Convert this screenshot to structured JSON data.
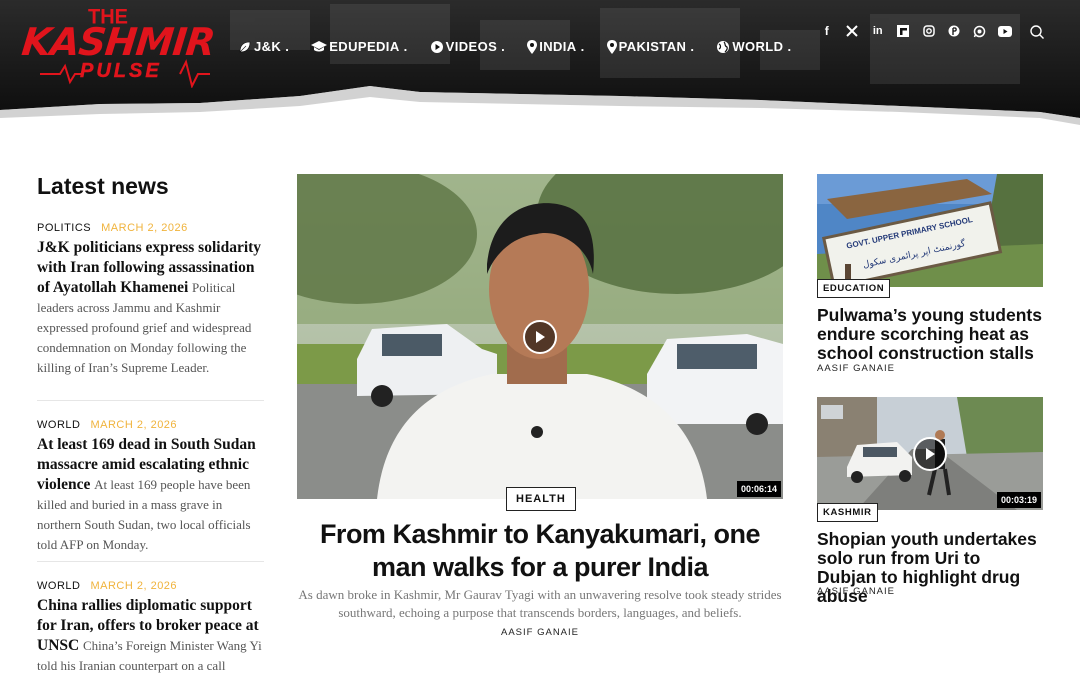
{
  "brand": {
    "the": "THE",
    "name": "KASHMIR",
    "tagline": "PULSE",
    "accent": "#e1141c"
  },
  "nav": {
    "items": [
      {
        "label": "J&K",
        "icon": "leaf-icon"
      },
      {
        "label": "EDUPEDIA",
        "icon": "graduation-cap-icon"
      },
      {
        "label": "VIDEOS",
        "icon": "play-circle-icon"
      },
      {
        "label": "INDIA",
        "icon": "map-pin-icon"
      },
      {
        "label": "PAKISTAN",
        "icon": "map-pin-icon"
      },
      {
        "label": "WORLD",
        "icon": "globe-icon"
      }
    ],
    "separator": "."
  },
  "social": {
    "icons": [
      "facebook-icon",
      "x-icon",
      "linkedin-icon",
      "flipboard-icon",
      "instagram-icon",
      "pinterest-icon",
      "whatsapp-icon",
      "youtube-icon"
    ],
    "glyphs": {
      "facebook": "f",
      "x": "𝕏",
      "linkedin": "in",
      "pinterest": "P"
    }
  },
  "latest": {
    "title": "Latest news",
    "items": [
      {
        "category": "POLITICS",
        "date": "MARCH 2, 2026",
        "headline": "J&K politicians express solidarity with Iran following assassination of Ayatollah Khamenei",
        "excerpt": "Political leaders across Jammu and Kashmir expressed profound grief and widespread condemnation on Monday following the killing of Iran’s Supreme Leader."
      },
      {
        "category": "WORLD",
        "date": "MARCH 2, 2026",
        "headline": "At least 169 dead in South Sudan massacre amid escalating ethnic violence",
        "excerpt": "At least 169 people have been killed and buried in a mass grave in northern South Sudan, two local officials told AFP on Monday."
      },
      {
        "category": "WORLD",
        "date": "MARCH 2, 2026",
        "headline": "China rallies diplomatic support for Iran, offers to broker peace at UNSC",
        "excerpt": "China’s Foreign Minister Wang Yi told his Iranian counterpart on a call"
      }
    ]
  },
  "feature": {
    "category": "HEALTH",
    "duration": "00:06:14",
    "title": "From Kashmir to Kanyakumari, one man walks for a purer India",
    "excerpt": "As dawn broke in Kashmir, Mr Gaurav Tyagi with an unwavering resolve took steady strides southward, echoing a purpose that transcends borders, languages, and beliefs.",
    "author": "AASIF GANAIE"
  },
  "side": [
    {
      "category": "EDUCATION",
      "title": "Pulwama’s young students endure scorching heat as school construction stalls",
      "author": "AASIF GANAIE",
      "sign_text": "GOVT. UPPER PRIMARY SCHOOL",
      "sign_urdu": "گورنمنٹ اپر پرائمری سکول"
    },
    {
      "category": "KASHMIR",
      "title": "Shopian youth undertakes solo run from Uri to Dubjan to highlight drug abuse",
      "author": "AASIF GANAIE",
      "duration": "00:03:19"
    }
  ]
}
